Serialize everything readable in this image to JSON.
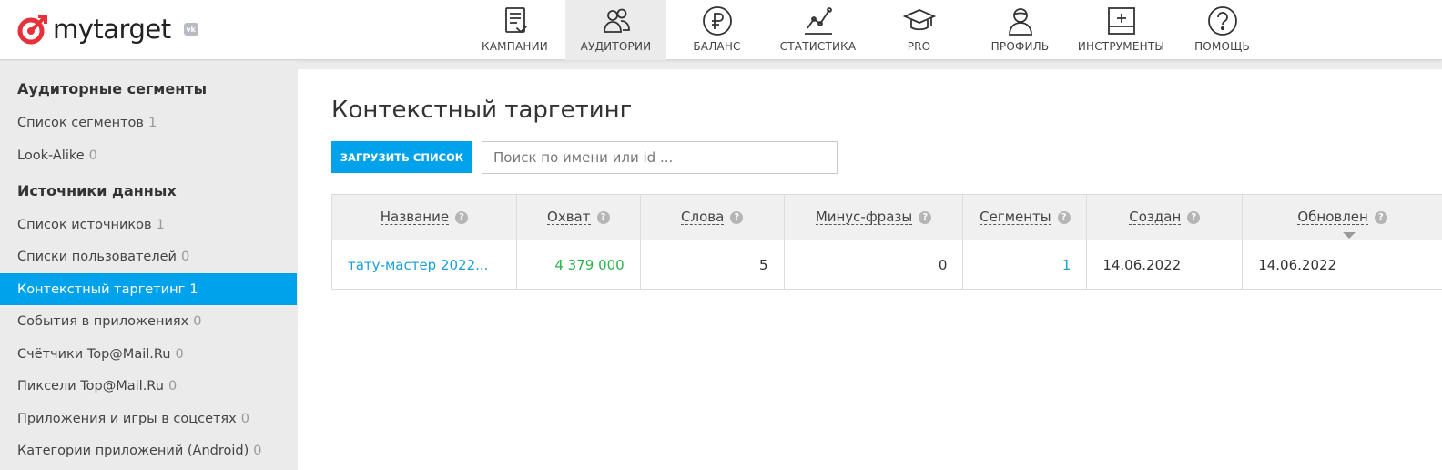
{
  "header": {
    "logo_text": "mytarget",
    "vk_badge": "vk",
    "nav": [
      {
        "label": "КАМПАНИИ",
        "icon": "campaigns-icon",
        "active": false
      },
      {
        "label": "АУДИТОРИИ",
        "icon": "audiences-icon",
        "active": true
      },
      {
        "label": "БАЛАНС",
        "icon": "ruble-icon",
        "active": false
      },
      {
        "label": "СТАТИСТИКА",
        "icon": "statistics-icon",
        "active": false
      },
      {
        "label": "PRO",
        "icon": "graduation-cap-icon",
        "active": false
      },
      {
        "label": "ПРОФИЛЬ",
        "icon": "profile-icon",
        "active": false
      },
      {
        "label": "ИНСТРУМЕНТЫ",
        "icon": "tools-icon",
        "active": false
      },
      {
        "label": "ПОМОЩЬ",
        "icon": "help-icon",
        "active": false
      }
    ]
  },
  "sidebar": {
    "section1": {
      "heading": "Аудиторные сегменты",
      "items": [
        {
          "label": "Список сегментов",
          "count": "1"
        },
        {
          "label": "Look-Alike",
          "count": "0"
        }
      ]
    },
    "section2": {
      "heading": "Источники данных",
      "items": [
        {
          "label": "Список источников",
          "count": "1"
        },
        {
          "label": "Списки пользователей",
          "count": "0"
        },
        {
          "label": "Контекстный таргетинг",
          "count": "1"
        },
        {
          "label": "События в приложениях",
          "count": "0"
        },
        {
          "label": "Счётчики Top@Mail.Ru",
          "count": "0"
        },
        {
          "label": "Пиксели Top@Mail.Ru",
          "count": "0"
        },
        {
          "label": "Приложения и игры в соцсетях",
          "count": "0"
        },
        {
          "label": "Категории приложений (Android)",
          "count": "0"
        }
      ]
    }
  },
  "main": {
    "title": "Контекстный таргетинг",
    "upload_button": "ЗАГРУЗИТЬ СПИСОК",
    "search_placeholder": "Поиск по имени или id ...",
    "table": {
      "columns": [
        "Название",
        "Охват",
        "Слова",
        "Минус-фразы",
        "Сегменты",
        "Создан",
        "Обновлен"
      ],
      "help_glyph": "?",
      "rows": [
        {
          "name": "тату-мастер 2022...",
          "reach": "4 379 000",
          "words": "5",
          "minus_phrases": "0",
          "segments": "1",
          "created": "14.06.2022",
          "updated": "14.06.2022"
        }
      ]
    }
  },
  "colors": {
    "accent": "#00a3eb",
    "link": "#1a9fd9",
    "reach_green": "#2ab34a",
    "logo_red": "#e8303a"
  }
}
